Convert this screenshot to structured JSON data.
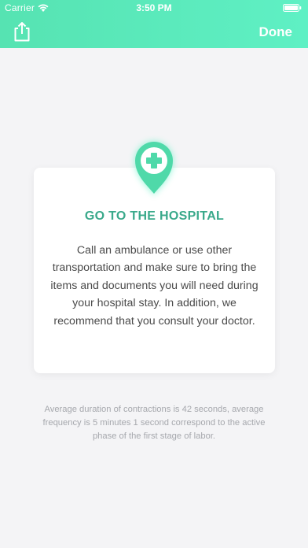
{
  "status_bar": {
    "carrier": "Carrier",
    "time": "3:50 PM"
  },
  "nav": {
    "share_icon": "share-icon",
    "done_label": "Done"
  },
  "card": {
    "icon": "hospital-pin-icon",
    "title": "GO TO THE HOSPITAL",
    "body": "Call an ambulance or use other transportation and make sure to bring the items and documents you will need during your hospital stay. In addition, we recommend that you consult your doctor."
  },
  "footnote": "Average duration of contractions is 42 seconds, average frequency is 5 minutes 1 second correspond to the active phase of the first stage of labor.",
  "colors": {
    "header_start": "#56e3b2",
    "header_end": "#5ff0c4",
    "accent": "#3aa98b",
    "background": "#f4f4f6"
  }
}
